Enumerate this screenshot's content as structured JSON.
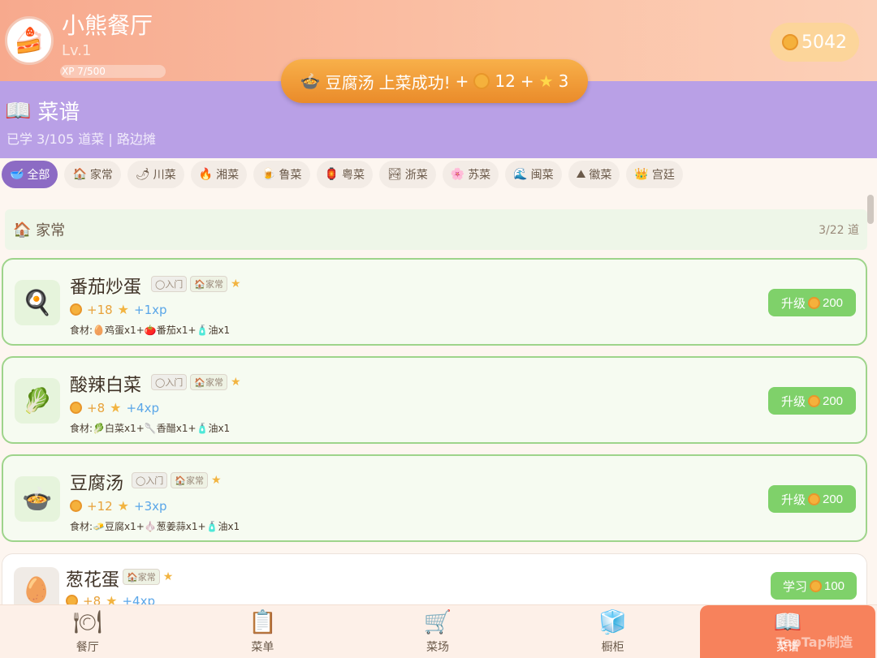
{
  "header": {
    "restaurant_name": "小熊餐厅",
    "level": "Lv.1",
    "xp": "XP 7/500",
    "coins": "5042",
    "avatar_icon": "cake-icon"
  },
  "toast": {
    "dish": "豆腐汤",
    "message": "上菜成功!",
    "coin_reward": "+",
    "coin_value": "12",
    "star_reward": "+",
    "star_value": "3"
  },
  "banner": {
    "title": "菜谱",
    "subtitle": "已学 3/105 道菜 |  路边摊"
  },
  "categories": [
    {
      "label": "全部",
      "icon": "🥣"
    },
    {
      "label": "家常",
      "icon": "🏠"
    },
    {
      "label": "川菜",
      "icon": "🌶"
    },
    {
      "label": "湘菜",
      "icon": "🔥"
    },
    {
      "label": "鲁菜",
      "icon": "🍺"
    },
    {
      "label": "粤菜",
      "icon": "🏮"
    },
    {
      "label": "浙菜",
      "icon": "🏞"
    },
    {
      "label": "苏菜",
      "icon": "🌸"
    },
    {
      "label": "闽菜",
      "icon": "🌊"
    },
    {
      "label": "徽菜",
      "icon": "⛰"
    },
    {
      "label": "宫廷",
      "icon": "👑"
    }
  ],
  "group": {
    "name": "家常",
    "count": "3/22 道"
  },
  "dishes": [
    {
      "name": "番茄炒蛋",
      "tag_level": "入门",
      "tag_cat": "家常",
      "gold": "+18",
      "xp": "+1xp",
      "ingredients": "食材:🥚鸡蛋x1+🍅番茄x1+🧴油x1",
      "button_label": "升级",
      "button_cost": "200",
      "icon": "🍳"
    },
    {
      "name": "酸辣白菜",
      "tag_level": "入门",
      "tag_cat": "家常",
      "gold": "+8",
      "xp": "+4xp",
      "ingredients": "食材:🥬白菜x1+🥄香醋x1+🧴油x1",
      "button_label": "升级",
      "button_cost": "200",
      "icon": "🥬"
    },
    {
      "name": "豆腐汤",
      "tag_level": "入门",
      "tag_cat": "家常",
      "gold": "+12",
      "xp": "+3xp",
      "ingredients": "食材:🧈豆腐x1+🧄葱姜蒜x1+🧴油x1",
      "button_label": "升级",
      "button_cost": "200",
      "icon": "🍲"
    },
    {
      "name": "葱花蛋",
      "tag_cat": "家常",
      "gold": "+8",
      "xp": "+4xp",
      "button_label": "学习",
      "button_cost": "100",
      "icon": "🥚"
    }
  ],
  "nav": [
    {
      "label": "餐厅",
      "icon": "🍽"
    },
    {
      "label": "菜单",
      "icon": "📋"
    },
    {
      "label": "菜场",
      "icon": "🛒"
    },
    {
      "label": "橱柜",
      "icon": "🧊"
    },
    {
      "label": "菜谱",
      "icon": "📖"
    }
  ],
  "watermark": "TapTap制造"
}
